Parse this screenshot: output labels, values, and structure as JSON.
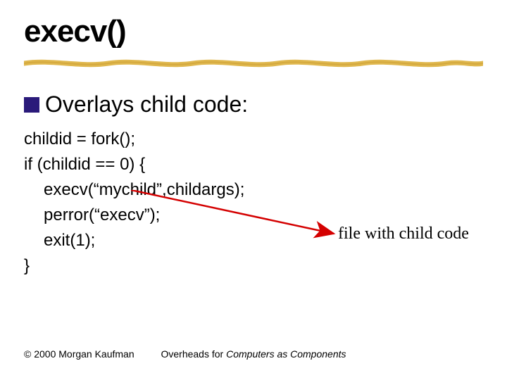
{
  "title": "execv()",
  "bullet": "Overlays child code:",
  "code": {
    "l1": "childid = fork();",
    "l2": "if (childid == 0) {",
    "l3": "execv(“mychild”,childargs);",
    "l4": "perror(“execv”);",
    "l5": "exit(1);",
    "l6": "}"
  },
  "annotation": "file with child code",
  "footer": {
    "left": "© 2000 Morgan Kaufman",
    "center_plain": "Overheads for ",
    "center_italic": "Computers as Components"
  },
  "colors": {
    "bullet_square": "#2a1a7a",
    "underline": "#e0b84f",
    "arrow": "#d40000"
  }
}
